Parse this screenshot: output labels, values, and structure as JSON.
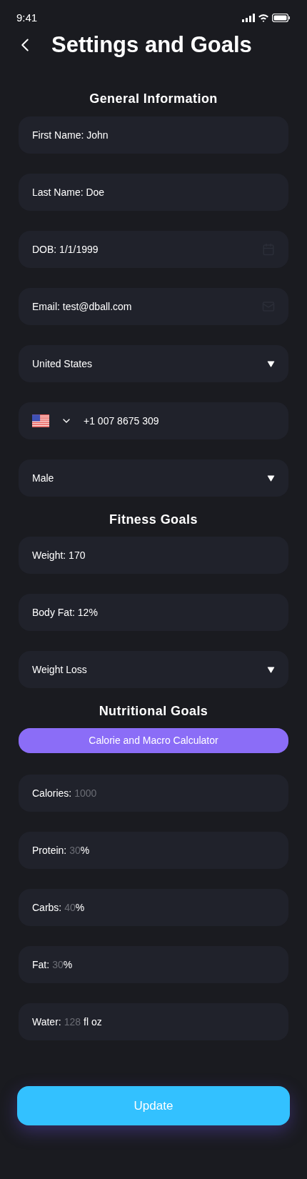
{
  "status_bar": {
    "time": "9:41"
  },
  "header": {
    "title": "Settings and Goals"
  },
  "sections": [
    {
      "title": "General Information",
      "fields": [
        {
          "kind": "text",
          "value": "First Name: John"
        },
        {
          "kind": "text",
          "value": "Last Name: Doe"
        },
        {
          "kind": "date",
          "value": "DOB: 1/1/1999"
        },
        {
          "kind": "email",
          "value": "Email: test@dball.com"
        },
        {
          "kind": "select",
          "value": "United States"
        },
        {
          "kind": "phone",
          "value": "+1 007 8675 309"
        },
        {
          "kind": "select",
          "value": "Male"
        }
      ]
    },
    {
      "title": "Fitness Goals",
      "fields": [
        {
          "kind": "text",
          "value": "Weight: 170"
        },
        {
          "kind": "text",
          "value": "Body Fat: 12%"
        },
        {
          "kind": "select",
          "value": "Weight Loss"
        }
      ]
    },
    {
      "title": "Nutritional Goals",
      "button": "Calorie and Macro Calculator",
      "fields": [
        {
          "kind": "goal",
          "label": "Calories:",
          "placeholder": "1000"
        },
        {
          "kind": "goal",
          "label": "Protein:",
          "placeholder": "30",
          "suffix": "%"
        },
        {
          "kind": "goal",
          "label": "Carbs:",
          "placeholder": "40",
          "suffix": "%"
        },
        {
          "kind": "goal",
          "label": "Fat:",
          "placeholder": "30",
          "suffix": "%"
        },
        {
          "kind": "goal",
          "label": "Water:",
          "placeholder": "128",
          "suffix": "fl oz"
        }
      ]
    }
  ],
  "update_button": "Update"
}
